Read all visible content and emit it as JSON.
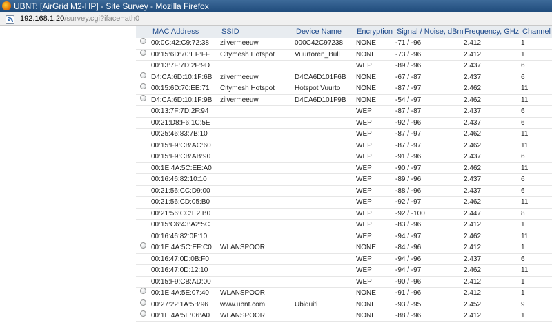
{
  "window": {
    "title": "UBNT: [AirGrid M2-HP] - Site Survey - Mozilla Firefox"
  },
  "urlbar": {
    "host": "192.168.1.20",
    "path": "/survey.cgi?iface=ath0"
  },
  "table": {
    "headers": [
      "MAC Address",
      "SSID",
      "Device Name",
      "Encryption",
      "Signal / Noise, dBm",
      "Frequency, GHz",
      "Channel"
    ],
    "rows": [
      {
        "radio": true,
        "mac": "00:0C:42:C9:72:38",
        "ssid": "zilvermeeuw",
        "device": "000C42C97238",
        "enc": "NONE",
        "signal": "-71 / -96",
        "freq": "2.412",
        "ch": "1"
      },
      {
        "radio": true,
        "mac": "00:15:6D:70:EF:FF",
        "ssid": "Citymesh Hotspot",
        "device": "Vuurtoren_Bull",
        "enc": "NONE",
        "signal": "-73 / -96",
        "freq": "2.412",
        "ch": "1"
      },
      {
        "radio": false,
        "mac": "00:13:7F:7D:2F:9D",
        "ssid": "",
        "device": "",
        "enc": "WEP",
        "signal": "-89 / -96",
        "freq": "2.437",
        "ch": "6"
      },
      {
        "radio": true,
        "mac": "D4:CA:6D:10:1F:6B",
        "ssid": "zilvermeeuw",
        "device": "D4CA6D101F6B",
        "enc": "NONE",
        "signal": "-67 / -87",
        "freq": "2.437",
        "ch": "6"
      },
      {
        "radio": true,
        "mac": "00:15:6D:70:EE:71",
        "ssid": "Citymesh Hotspot",
        "device": "Hotspot Vuurto",
        "enc": "NONE",
        "signal": "-87 / -97",
        "freq": "2.462",
        "ch": "11"
      },
      {
        "radio": true,
        "mac": "D4:CA:6D:10:1F:9B",
        "ssid": "zilvermeeuw",
        "device": "D4CA6D101F9B",
        "enc": "NONE",
        "signal": "-54 / -97",
        "freq": "2.462",
        "ch": "11"
      },
      {
        "radio": false,
        "mac": "00:13:7F:7D:2F:94",
        "ssid": "",
        "device": "",
        "enc": "WEP",
        "signal": "-87 / -87",
        "freq": "2.437",
        "ch": "6"
      },
      {
        "radio": false,
        "mac": "00:21:D8:F6:1C:5E",
        "ssid": "",
        "device": "",
        "enc": "WEP",
        "signal": "-92 / -96",
        "freq": "2.437",
        "ch": "6"
      },
      {
        "radio": false,
        "mac": "00:25:46:83:7B:10",
        "ssid": "",
        "device": "",
        "enc": "WEP",
        "signal": "-87 / -97",
        "freq": "2.462",
        "ch": "11"
      },
      {
        "radio": false,
        "mac": "00:15:F9:CB:AC:60",
        "ssid": "",
        "device": "",
        "enc": "WEP",
        "signal": "-87 / -97",
        "freq": "2.462",
        "ch": "11"
      },
      {
        "radio": false,
        "mac": "00:15:F9:CB:AB:90",
        "ssid": "",
        "device": "",
        "enc": "WEP",
        "signal": "-91 / -96",
        "freq": "2.437",
        "ch": "6"
      },
      {
        "radio": false,
        "mac": "00:1E:4A:5C:EE:A0",
        "ssid": "",
        "device": "",
        "enc": "WEP",
        "signal": "-90 / -97",
        "freq": "2.462",
        "ch": "11"
      },
      {
        "radio": false,
        "mac": "00:16:46:82:10:10",
        "ssid": "",
        "device": "",
        "enc": "WEP",
        "signal": "-89 / -96",
        "freq": "2.437",
        "ch": "6"
      },
      {
        "radio": false,
        "mac": "00:21:56:CC:D9:00",
        "ssid": "",
        "device": "",
        "enc": "WEP",
        "signal": "-88 / -96",
        "freq": "2.437",
        "ch": "6"
      },
      {
        "radio": false,
        "mac": "00:21:56:CD:05:B0",
        "ssid": "",
        "device": "",
        "enc": "WEP",
        "signal": "-92 / -97",
        "freq": "2.462",
        "ch": "11"
      },
      {
        "radio": false,
        "mac": "00:21:56:CC:E2:B0",
        "ssid": "",
        "device": "",
        "enc": "WEP",
        "signal": "-92 / -100",
        "freq": "2.447",
        "ch": "8"
      },
      {
        "radio": false,
        "mac": "00:15:C6:43:A2:5C",
        "ssid": "",
        "device": "",
        "enc": "WEP",
        "signal": "-83 / -96",
        "freq": "2.412",
        "ch": "1"
      },
      {
        "radio": false,
        "mac": "00:16:46:82:0F:10",
        "ssid": "",
        "device": "",
        "enc": "WEP",
        "signal": "-94 / -97",
        "freq": "2.462",
        "ch": "11"
      },
      {
        "radio": true,
        "mac": "00:1E:4A:5C:EF:C0",
        "ssid": "WLANSPOOR",
        "device": "",
        "enc": "NONE",
        "signal": "-84 / -96",
        "freq": "2.412",
        "ch": "1"
      },
      {
        "radio": false,
        "mac": "00:16:47:0D:0B:F0",
        "ssid": "",
        "device": "",
        "enc": "WEP",
        "signal": "-94 / -96",
        "freq": "2.437",
        "ch": "6"
      },
      {
        "radio": false,
        "mac": "00:16:47:0D:12:10",
        "ssid": "",
        "device": "",
        "enc": "WEP",
        "signal": "-94 / -97",
        "freq": "2.462",
        "ch": "11"
      },
      {
        "radio": false,
        "mac": "00:15:F9:CB:AD:00",
        "ssid": "",
        "device": "",
        "enc": "WEP",
        "signal": "-90 / -96",
        "freq": "2.412",
        "ch": "1"
      },
      {
        "radio": true,
        "mac": "00:1E:4A:5E:07:40",
        "ssid": "WLANSPOOR",
        "device": "",
        "enc": "NONE",
        "signal": "-91 / -96",
        "freq": "2.412",
        "ch": "1"
      },
      {
        "radio": true,
        "mac": "00:27:22:1A:5B:96",
        "ssid": "www.ubnt.com",
        "device": "Ubiquiti",
        "enc": "NONE",
        "signal": "-93 / -95",
        "freq": "2.452",
        "ch": "9"
      },
      {
        "radio": true,
        "mac": "00:1E:4A:5E:06:A0",
        "ssid": "WLANSPOOR",
        "device": "",
        "enc": "NONE",
        "signal": "-88 / -96",
        "freq": "2.412",
        "ch": "1"
      }
    ]
  }
}
